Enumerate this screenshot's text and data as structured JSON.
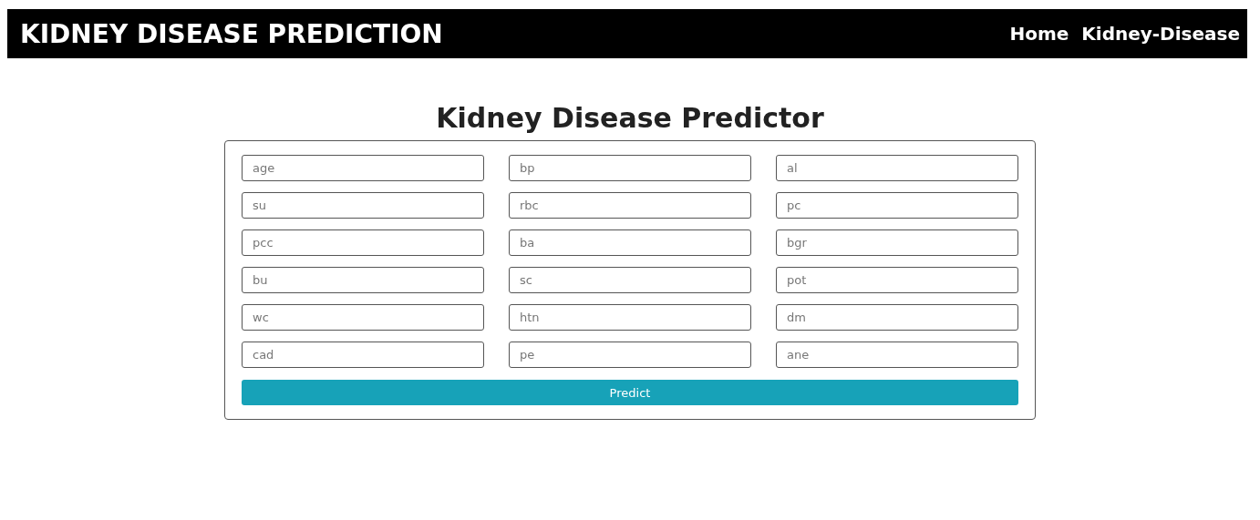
{
  "navbar": {
    "brand": "KIDNEY DISEASE PREDICTION",
    "links": [
      "Home",
      "Kidney-Disease"
    ]
  },
  "heading": "Kidney Disease Predictor",
  "form": {
    "fields": [
      {
        "placeholder": "age"
      },
      {
        "placeholder": "bp"
      },
      {
        "placeholder": "al"
      },
      {
        "placeholder": "su"
      },
      {
        "placeholder": "rbc"
      },
      {
        "placeholder": "pc"
      },
      {
        "placeholder": "pcc"
      },
      {
        "placeholder": "ba"
      },
      {
        "placeholder": "bgr"
      },
      {
        "placeholder": "bu"
      },
      {
        "placeholder": "sc"
      },
      {
        "placeholder": "pot"
      },
      {
        "placeholder": "wc"
      },
      {
        "placeholder": "htn"
      },
      {
        "placeholder": "dm"
      },
      {
        "placeholder": "cad"
      },
      {
        "placeholder": "pe"
      },
      {
        "placeholder": "ane"
      }
    ],
    "button": "Predict"
  }
}
